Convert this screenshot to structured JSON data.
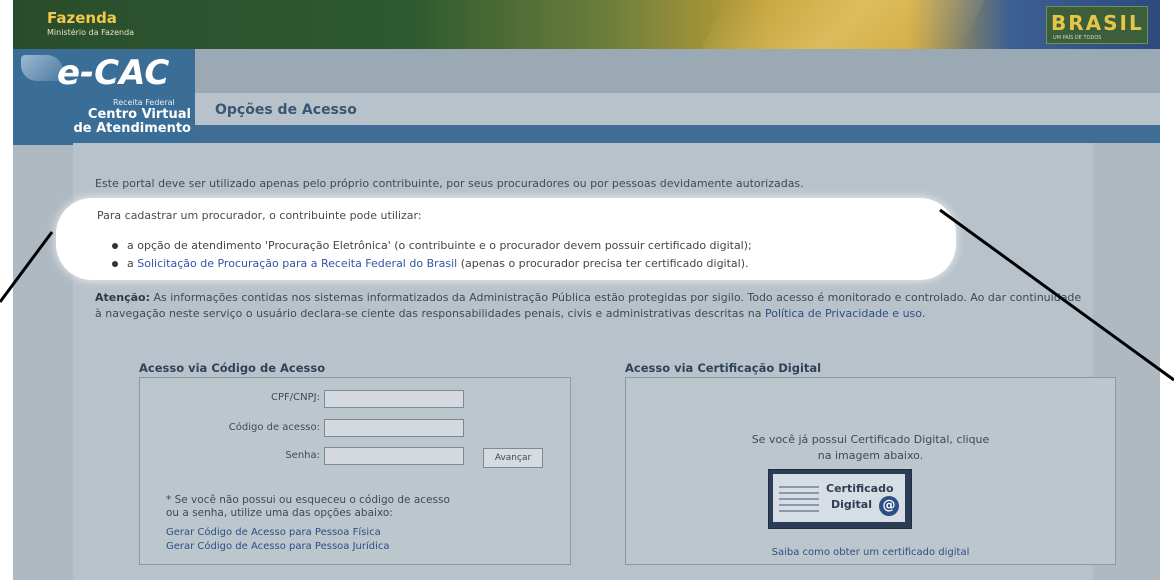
{
  "banner": {
    "title": "Fazenda",
    "subtitle": "Ministério da Fazenda",
    "brasil_logo": "BRASIL",
    "brasil_tagline": "UM PAÍS DE TODOS"
  },
  "logo": {
    "ecac": "e-CAC",
    "receita": "Receita Federal",
    "centro_line1": "Centro Virtual",
    "centro_line2": "de Atendimento"
  },
  "header": {
    "page_title": "Opções de Acesso"
  },
  "content": {
    "intro": "Este portal deve ser utilizado apenas pelo próprio contribuinte, por seus procuradores ou por pessoas devidamente autorizadas.",
    "procurador_intro": "Para cadastrar um procurador, o contribuinte pode utilizar:",
    "bullet1": "a opção de atendimento 'Procuração Eletrônica' (o contribuinte e o procurador devem possuir certificado digital);",
    "bullet2_prefix": "a",
    "bullet2_link": "Solicitação de Procuração para a Receita Federal do Brasil",
    "bullet2_suffix": "(apenas o procurador precisa ter certificado digital).",
    "attention_label": "Atenção:",
    "attention_text": "As informações contidas nos sistemas informatizados da Administração Pública estão protegidas por sigilo. Todo acesso é monitorado e controlado. Ao dar continuidade à navegação neste serviço o usuário declara-se ciente das responsabilidades penais, civis e administrativas descritas na",
    "privacy_link": "Política de Privacidade e uso",
    "privacy_suffix": "."
  },
  "access_code": {
    "title": "Acesso via Código de Acesso",
    "cpf_label": "CPF/CNPJ:",
    "code_label": "Código de acesso:",
    "password_label": "Senha:",
    "submit_label": "Avançar",
    "note_line1": "* Se você não possui ou esqueceu o código de acesso",
    "note_line2": "ou a senha, utilize uma das opções abaixo:",
    "link_pf": "Gerar Código de Acesso para Pessoa Física",
    "link_pj": "Gerar Código de Acesso para Pessoa Jurídica"
  },
  "digital_cert": {
    "title": "Acesso via Certificação Digital",
    "text_line1": "Se você já possui Certificado Digital, clique",
    "text_line2": "na imagem abaixo.",
    "image_line1": "Certificado",
    "image_line2": "Digital",
    "image_symbol": "@",
    "link": "Saiba como obter um certificado digital"
  },
  "colors": {
    "overlay": "#aeb9c2",
    "header_blue": "#3f6d95",
    "link_blue": "#2e55a8",
    "highlight": "#ffffff"
  }
}
